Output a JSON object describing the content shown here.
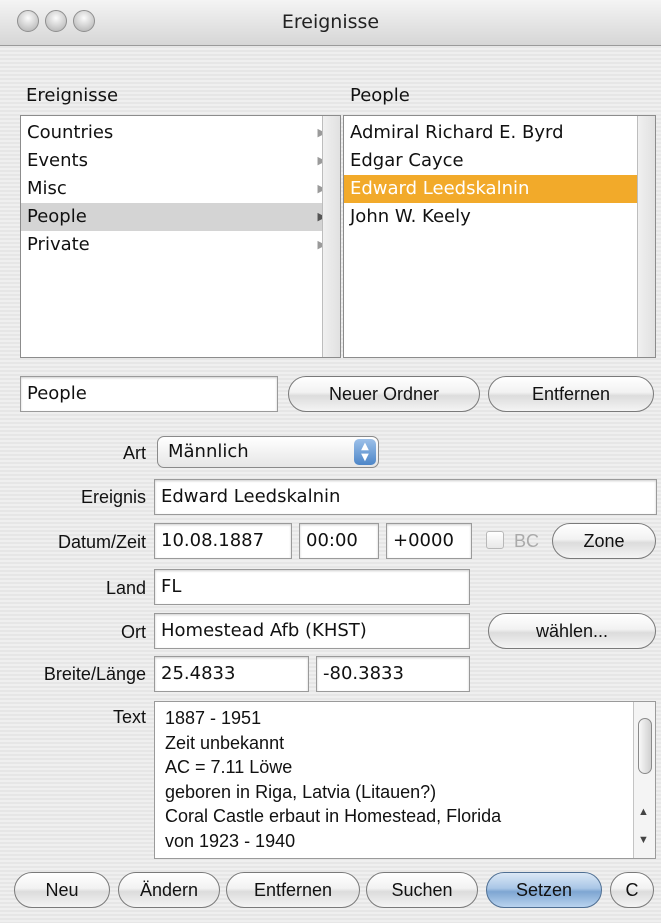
{
  "window": {
    "title": "Ereignisse"
  },
  "folders": {
    "header": "Ereignisse",
    "items": [
      {
        "label": "Countries",
        "selected": false
      },
      {
        "label": "Events",
        "selected": false
      },
      {
        "label": "Misc",
        "selected": false
      },
      {
        "label": "People",
        "selected": true
      },
      {
        "label": "Private",
        "selected": false
      }
    ]
  },
  "people": {
    "header": "People",
    "items": [
      {
        "label": "Admiral Richard E. Byrd",
        "selected": false
      },
      {
        "label": "Edgar Cayce",
        "selected": false
      },
      {
        "label": "Edward Leedskalnin",
        "selected": true
      },
      {
        "label": "John W. Keely",
        "selected": false
      }
    ]
  },
  "folder_bar": {
    "name_value": "People",
    "new_folder_label": "Neuer Ordner",
    "remove_label": "Entfernen"
  },
  "form": {
    "art_label": "Art",
    "art_value": "Männlich",
    "ereignis_label": "Ereignis",
    "ereignis_value": "Edward Leedskalnin",
    "datum_label": "Datum/Zeit",
    "date_value": "10.08.1887",
    "time_value": "00:00",
    "offset_value": "+0000",
    "bc_label": "BC",
    "bc_checked": false,
    "zone_label": "Zone",
    "land_label": "Land",
    "land_value": "FL",
    "ort_label": "Ort",
    "ort_value": "Homestead Afb (KHST)",
    "choose_label": "wählen...",
    "coords_label": "Breite/Länge",
    "lat_value": "25.4833",
    "lon_value": "-80.3833",
    "text_label": "Text",
    "text_lines": [
      "1887 - 1951",
      "Zeit unbekannt",
      "AC = 7.11 Löwe",
      "geboren in Riga, Latvia (Litauen?)",
      "Coral Castle erbaut in Homestead, Florida",
      "von 1923 - 1940"
    ]
  },
  "bottom_buttons": {
    "new": "Neu",
    "change": "Ändern",
    "remove": "Entfernen",
    "search": "Suchen",
    "set": "Setzen",
    "c": "C"
  },
  "colors": {
    "selection_orange": "#f2aa2a",
    "selection_grey": "#d4d4d4",
    "default_button": "#7ea6d2"
  }
}
